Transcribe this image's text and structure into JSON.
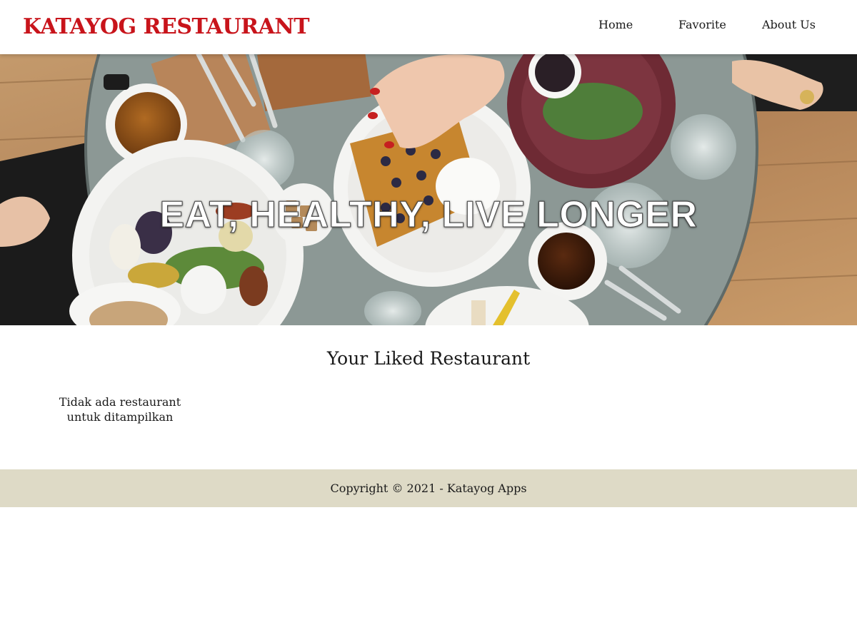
{
  "header": {
    "brand": "KATAYOG RESTAURANT",
    "nav": [
      {
        "label": "Home"
      },
      {
        "label": "Favorite"
      },
      {
        "label": "About Us"
      }
    ]
  },
  "hero": {
    "title": "EAT, HEALTHY, LIVE LONGER"
  },
  "main": {
    "title": "Your Liked Restaurant",
    "empty_message": "Tidak ada restaurant untuk ditampilkan"
  },
  "footer": {
    "copyright": "Copyright © 2021 - Katayog Apps"
  },
  "colors": {
    "brand": "#c8141b",
    "footer_bg": "#dedac6"
  }
}
